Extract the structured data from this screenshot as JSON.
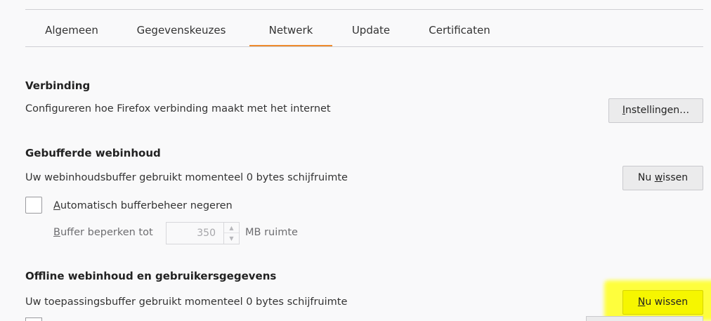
{
  "tabs": [
    {
      "label": "Algemeen"
    },
    {
      "label": "Gegevenskeuzes"
    },
    {
      "label": "Netwerk",
      "active": true
    },
    {
      "label": "Update"
    },
    {
      "label": "Certificaten"
    }
  ],
  "connection": {
    "title": "Verbinding",
    "description": "Configureren hoe Firefox verbinding maakt met het internet",
    "button_mnemonic": "I",
    "button_rest": "nstellingen…"
  },
  "web_cache": {
    "title": "Gebufferde webinhoud",
    "description": "Uw webinhoudsbuffer gebruikt momenteel 0 bytes schijfruimte",
    "button_pre": "Nu ",
    "button_mnemonic": "w",
    "button_post": "issen",
    "override_mnemonic": "A",
    "override_rest": "utomatisch bufferbeheer negeren",
    "override_checked": false,
    "limit_mnemonic": "B",
    "limit_rest": "uffer beperken tot",
    "limit_value": "350",
    "limit_unit": "MB ruimte"
  },
  "offline": {
    "title": "Offline webinhoud en gebruikersgegevens",
    "description": "Uw toepassingsbuffer gebruikt momenteel 0 bytes schijfruimte",
    "button_mnemonic": "N",
    "button_rest": "u wissen"
  },
  "colors": {
    "accent_tab": "#ee8b2d",
    "highlight": "#ffff33"
  }
}
